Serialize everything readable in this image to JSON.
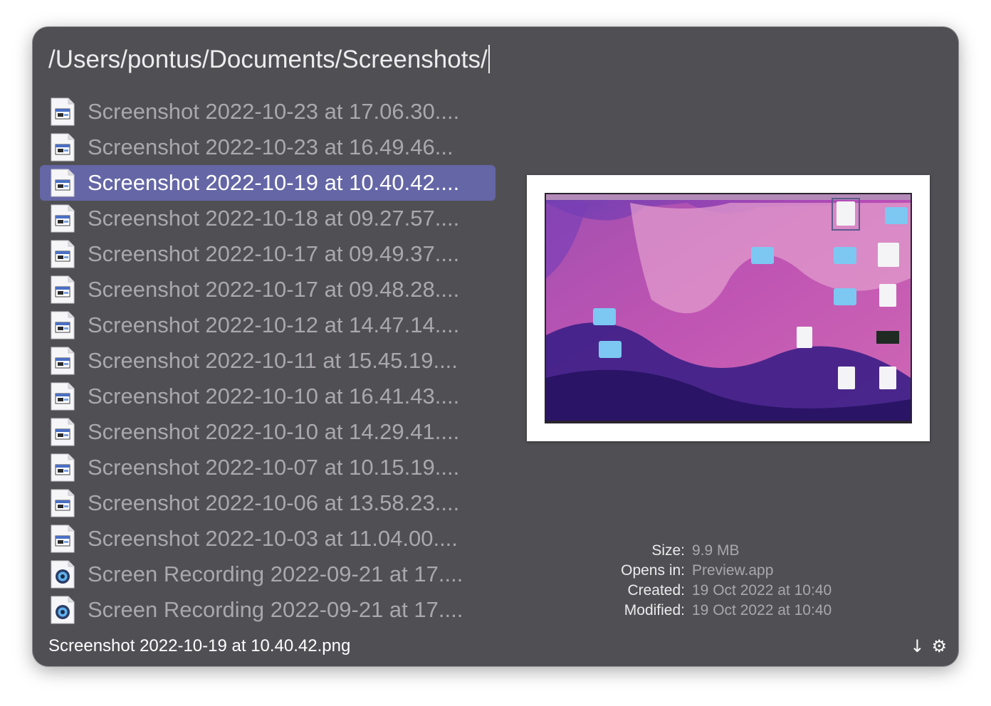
{
  "search": {
    "query": "/Users/pontus/Documents/Screenshots/"
  },
  "results": [
    {
      "name": "Screenshot 2022-10-23 at 17.06.30....",
      "icon": "png-file-icon"
    },
    {
      "name": "Screenshot 2022-10-23 at 16.49.46...",
      "icon": "png-file-icon"
    },
    {
      "name": "Screenshot 2022-10-19 at 10.40.42....",
      "icon": "png-file-icon",
      "selected": true
    },
    {
      "name": "Screenshot 2022-10-18 at 09.27.57....",
      "icon": "png-file-icon"
    },
    {
      "name": "Screenshot 2022-10-17 at 09.49.37....",
      "icon": "png-file-icon"
    },
    {
      "name": "Screenshot 2022-10-17 at 09.48.28....",
      "icon": "png-file-icon"
    },
    {
      "name": "Screenshot 2022-10-12 at 14.47.14....",
      "icon": "png-file-icon"
    },
    {
      "name": "Screenshot 2022-10-11 at 15.45.19....",
      "icon": "png-file-icon"
    },
    {
      "name": "Screenshot 2022-10-10 at 16.41.43....",
      "icon": "png-file-icon"
    },
    {
      "name": "Screenshot 2022-10-10 at 14.29.41....",
      "icon": "png-file-icon"
    },
    {
      "name": "Screenshot 2022-10-07 at 10.15.19....",
      "icon": "png-file-icon"
    },
    {
      "name": "Screenshot 2022-10-06 at 13.58.23....",
      "icon": "png-file-icon"
    },
    {
      "name": "Screenshot 2022-10-03 at 11.04.00....",
      "icon": "png-file-icon"
    },
    {
      "name": "Screen Recording 2022-09-21 at 17....",
      "icon": "quicktime-movie-icon"
    },
    {
      "name": "Screen Recording 2022-09-21 at 17....",
      "icon": "quicktime-movie-icon"
    }
  ],
  "preview": {
    "image": "desktop-screenshot-thumbnail"
  },
  "details": {
    "size_label": "Size:",
    "size_value": "9.9 MB",
    "opens_label": "Opens in:",
    "opens_value": "Preview.app",
    "created_label": "Created:",
    "created_value": "19 Oct 2022 at 10:40",
    "modified_label": "Modified:",
    "modified_value": "19 Oct 2022 at 10:40"
  },
  "footer": {
    "selected_file": "Screenshot 2022-10-19 at 10.40.42.png",
    "sort_icon": "↓",
    "settings_icon": "⚙"
  },
  "colors": {
    "window_bg": "#504f54",
    "selection": "#6466a6",
    "text_primary": "#ececec",
    "text_dim": "#a9a8ad"
  }
}
